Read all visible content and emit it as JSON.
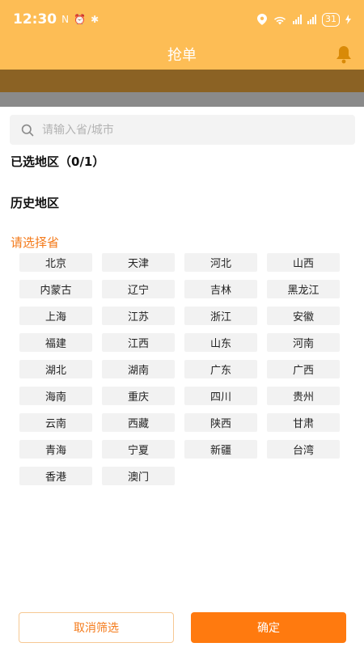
{
  "status_bar": {
    "time": "12:30",
    "icons_left": [
      "N",
      "⏰",
      "✱"
    ],
    "battery": "31"
  },
  "nav": {
    "title": "抢单"
  },
  "search": {
    "placeholder": "请输入省/城市",
    "value": ""
  },
  "sections": {
    "selected": "已选地区（0/1）",
    "history": "历史地区",
    "province": "请选择省"
  },
  "provinces": [
    "北京",
    "天津",
    "河北",
    "山西",
    "内蒙古",
    "辽宁",
    "吉林",
    "黑龙江",
    "上海",
    "江苏",
    "浙江",
    "安徽",
    "福建",
    "江西",
    "山东",
    "河南",
    "湖北",
    "湖南",
    "广东",
    "广西",
    "海南",
    "重庆",
    "四川",
    "贵州",
    "云南",
    "西藏",
    "陕西",
    "甘肃",
    "青海",
    "宁夏",
    "新疆",
    "台湾",
    "香港",
    "澳门"
  ],
  "buttons": {
    "reset": "取消筛选",
    "confirm": "确定"
  },
  "colors": {
    "header": "#fdbd55",
    "accent": "#ff7a0f",
    "section_highlight": "#f47a1a",
    "chip_bg": "#f2f2f2"
  }
}
